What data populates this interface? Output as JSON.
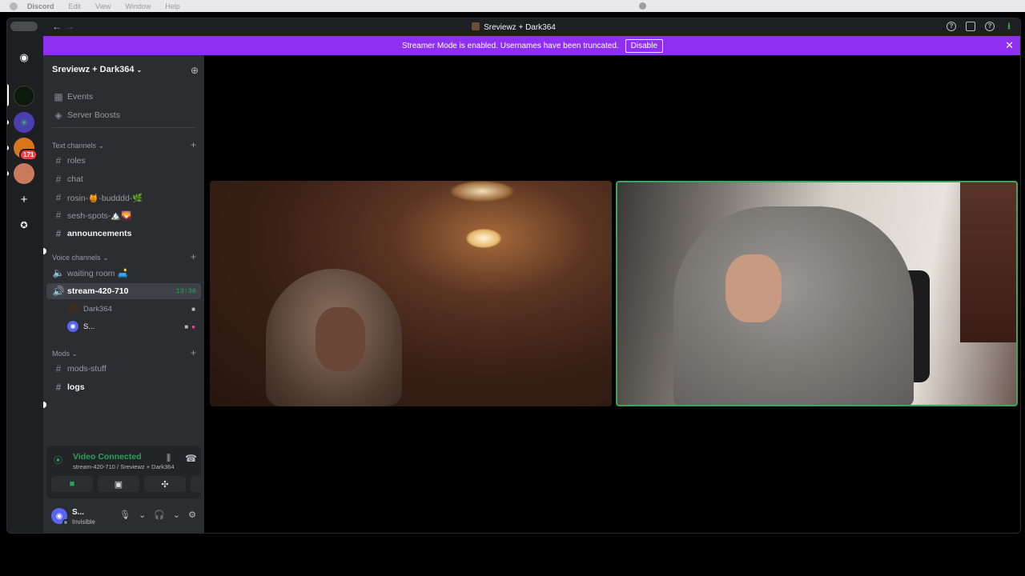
{
  "menubar": {
    "app": "Discord",
    "items": [
      "Edit",
      "View",
      "Window",
      "Help"
    ]
  },
  "window": {
    "title": "Sreviewz + Dark364"
  },
  "banner": {
    "text": "Streamer Mode is enabled. Usernames have been truncated.",
    "button": "Disable"
  },
  "servers": {
    "badge_count": "171"
  },
  "sidebar": {
    "server_name": "Sreviewz + Dark364",
    "top_items": [
      {
        "icon": "calendar-icon",
        "label": "Events"
      },
      {
        "icon": "boost-icon",
        "label": "Server Boosts"
      }
    ],
    "categories": {
      "text": "Text channels",
      "voice": "Voice channels",
      "mods": "Mods"
    },
    "text_channels": [
      "roles",
      "chat",
      "rosin-🍯-budddd-🌿",
      "sesh-spots-🏔️🌄",
      "announcements"
    ],
    "voice_channels": [
      {
        "label": "waiting room 🛋️"
      },
      {
        "label": "stream-420-710",
        "timer": "13:38"
      }
    ],
    "voice_users": [
      "Dark364",
      "S..."
    ],
    "mod_channels": [
      "mods-stuff",
      "logs"
    ]
  },
  "voice_panel": {
    "status": "Video Connected",
    "channel": "stream-420-710 / Sreviewz + Dark364"
  },
  "user": {
    "name": "S...",
    "status": "Invisible"
  },
  "colors": {
    "accent_green": "#23a559",
    "banner_purple": "#8f2ff0",
    "blurple": "#5865f2"
  }
}
